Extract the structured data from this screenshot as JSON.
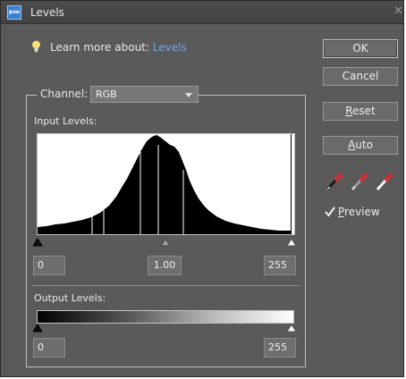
{
  "window": {
    "title": "Levels",
    "app_icon_text": "pse"
  },
  "learn_more": {
    "prefix": "Learn more about:",
    "link": "Levels"
  },
  "buttons": {
    "ok": "OK",
    "cancel": "Cancel",
    "reset_first": "R",
    "reset_rest": "eset",
    "auto_first": "A",
    "auto_rest": "uto"
  },
  "channel": {
    "label": "Channel:",
    "selected": "RGB"
  },
  "input_levels": {
    "label": "Input Levels:",
    "black": "0",
    "gamma": "1.00",
    "white": "255"
  },
  "output_levels": {
    "label": "Output Levels:",
    "black": "0",
    "white": "255"
  },
  "eyedroppers": [
    "black-point-eyedropper",
    "gray-point-eyedropper",
    "white-point-eyedropper"
  ],
  "preview": {
    "first": "P",
    "rest": "review",
    "checked": true
  },
  "colors": {
    "window_bg": "#5a5a5a",
    "link": "#6ea7e6",
    "histogram": "#000000"
  }
}
